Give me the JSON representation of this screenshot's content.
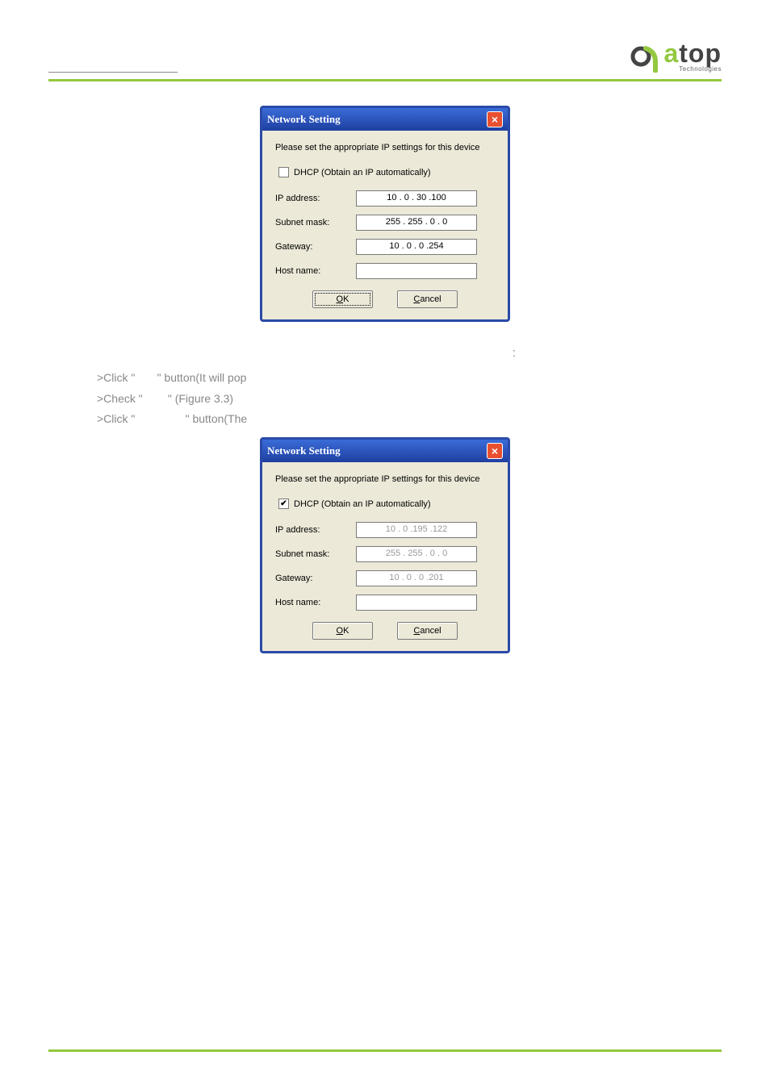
{
  "header": {
    "doc_title": ""
  },
  "logo": {
    "main_green": "a",
    "main_dark": "top",
    "sub": "Technologies"
  },
  "dialog1": {
    "title": "Network Setting",
    "message": "Please set the appropriate IP settings for this device",
    "dhcp_label": "DHCP (Obtain an IP automatically)",
    "dhcp_checked": false,
    "ip_label": "IP address:",
    "ip_value": "10 . 0 . 30 .100",
    "mask_label": "Subnet mask:",
    "mask_value": "255 . 255 . 0 . 0",
    "gw_label": "Gateway:",
    "gw_value": "10 . 0 . 0 .254",
    "host_label": "Host name:",
    "host_value": "",
    "ok": "OK",
    "cancel": "Cancel"
  },
  "caption1": "",
  "section_colon": ":",
  "steps": {
    "s1a": ">Click \"",
    "s1b": "\" button(It will pop",
    "s2a": ">Check \"",
    "s2b": "\" (Figure 3.3)",
    "s3a": ">Click \"",
    "s3b": "\" button(The"
  },
  "dialog2": {
    "title": "Network Setting",
    "message": "Please set the appropriate IP settings for this device",
    "dhcp_label": "DHCP (Obtain an IP automatically)",
    "dhcp_checked": true,
    "ip_label": "IP address:",
    "ip_value": "10 . 0 .195 .122",
    "mask_label": "Subnet mask:",
    "mask_value": "255 . 255 . 0 . 0",
    "gw_label": "Gateway:",
    "gw_value": "10 . 0 . 0 .201",
    "host_label": "Host name:",
    "host_value": "",
    "ok": "OK",
    "cancel": "Cancel"
  },
  "footer": {
    "left": "",
    "right": ""
  }
}
